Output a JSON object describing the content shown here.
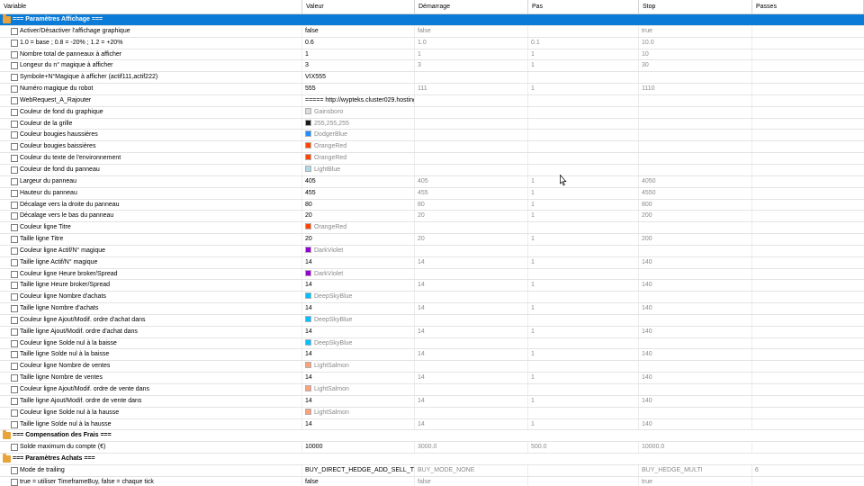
{
  "columns": [
    "Variable",
    "Valeur",
    "Démarrage",
    "Pas",
    "Stop",
    "Passes"
  ],
  "rows": [
    {
      "type": "section",
      "title": "=== Paramètres Affichage ===",
      "selected": true
    },
    {
      "type": "param",
      "name": "Activer/Désactiver l'affichage graphique",
      "value": "false",
      "start": "false",
      "step": "",
      "stop": "true",
      "passes": ""
    },
    {
      "type": "param",
      "name": "1.0 = base ; 0.8 = -20% ; 1.2 = +20%",
      "value": "0.6",
      "start": "1.0",
      "step": "0.1",
      "stop": "10.0",
      "passes": ""
    },
    {
      "type": "param",
      "name": "Nombre total de panneaux à afficher",
      "value": "1",
      "start": "1",
      "step": "1",
      "stop": "10",
      "passes": ""
    },
    {
      "type": "param",
      "name": "Longeur du n° magique à afficher",
      "value": "3",
      "start": "3",
      "step": "1",
      "stop": "30",
      "passes": ""
    },
    {
      "type": "param",
      "name": "Symbole+N°Magique à afficher (actif111,actif222)",
      "value": "VIX555",
      "start": "",
      "step": "",
      "stop": "",
      "passes": ""
    },
    {
      "type": "param",
      "name": "Numéro magique du robot",
      "value": "555",
      "start": "111",
      "step": "1",
      "stop": "1110",
      "passes": ""
    },
    {
      "type": "param",
      "name": "WebRequest_A_Rajouter",
      "value": "===== http://wypteks.cluster029.hosting.ovh.net =====",
      "start": "",
      "step": "",
      "stop": "",
      "passes": ""
    },
    {
      "type": "color",
      "name": "Couleur de fond du graphique",
      "value": "Gainsboro",
      "color": "#dcdcdc"
    },
    {
      "type": "color",
      "name": "Couleur de la grille",
      "value": "255,255,255",
      "color": "#1a1a1a"
    },
    {
      "type": "color",
      "name": "Couleur bougies haussières",
      "value": "DodgerBlue",
      "color": "#1e90ff"
    },
    {
      "type": "color",
      "name": "Couleur bougies baissières",
      "value": "OrangeRed",
      "color": "#ff4500"
    },
    {
      "type": "color",
      "name": "Couleur du texte de l'environnement",
      "value": "OrangeRed",
      "color": "#ff4500"
    },
    {
      "type": "color",
      "name": "Couleur de fond du panneau",
      "value": "LightBlue",
      "color": "#add8e6"
    },
    {
      "type": "param",
      "name": "Largeur du panneau",
      "value": "405",
      "start": "405",
      "step": "1",
      "stop": "4050",
      "passes": ""
    },
    {
      "type": "param",
      "name": "Hauteur du panneau",
      "value": "455",
      "start": "455",
      "step": "1",
      "stop": "4550",
      "passes": ""
    },
    {
      "type": "param",
      "name": "Décalage vers la droite du panneau",
      "value": "80",
      "start": "80",
      "step": "1",
      "stop": "800",
      "passes": ""
    },
    {
      "type": "param",
      "name": "Décalage vers le bas du panneau",
      "value": "20",
      "start": "20",
      "step": "1",
      "stop": "200",
      "passes": ""
    },
    {
      "type": "color",
      "name": "Couleur ligne Titre",
      "value": "OrangeRed",
      "color": "#ff4500"
    },
    {
      "type": "param",
      "name": "Taille ligne Titre",
      "value": "20",
      "start": "20",
      "step": "1",
      "stop": "200",
      "passes": ""
    },
    {
      "type": "color",
      "name": "Couleur ligne Actif/N° magique",
      "value": "DarkViolet",
      "color": "#9400d3"
    },
    {
      "type": "param",
      "name": "Taille ligne Actif/N° magique",
      "value": "14",
      "start": "14",
      "step": "1",
      "stop": "140",
      "passes": ""
    },
    {
      "type": "color",
      "name": "Couleur ligne Heure broker/Spread",
      "value": "DarkViolet",
      "color": "#9400d3"
    },
    {
      "type": "param",
      "name": "Taille ligne Heure broker/Spread",
      "value": "14",
      "start": "14",
      "step": "1",
      "stop": "140",
      "passes": ""
    },
    {
      "type": "color",
      "name": "Couleur ligne Nombre d'achats",
      "value": "DeepSkyBlue",
      "color": "#00bfff"
    },
    {
      "type": "param",
      "name": "Taille ligne Nombre d'achats",
      "value": "14",
      "start": "14",
      "step": "1",
      "stop": "140",
      "passes": ""
    },
    {
      "type": "color",
      "name": "Couleur ligne Ajout/Modif. ordre d'achat dans",
      "value": "DeepSkyBlue",
      "color": "#00bfff"
    },
    {
      "type": "param",
      "name": "Taille ligne Ajout/Modif. ordre d'achat dans",
      "value": "14",
      "start": "14",
      "step": "1",
      "stop": "140",
      "passes": ""
    },
    {
      "type": "color",
      "name": "Couleur ligne Solde nul à la baisse",
      "value": "DeepSkyBlue",
      "color": "#00bfff"
    },
    {
      "type": "param",
      "name": "Taille ligne Solde nul à la baisse",
      "value": "14",
      "start": "14",
      "step": "1",
      "stop": "140",
      "passes": ""
    },
    {
      "type": "color",
      "name": "Couleur ligne Nombre de ventes",
      "value": "LightSalmon",
      "color": "#ffa07a"
    },
    {
      "type": "param",
      "name": "Taille ligne Nombre de ventes",
      "value": "14",
      "start": "14",
      "step": "1",
      "stop": "140",
      "passes": ""
    },
    {
      "type": "color",
      "name": "Couleur ligne Ajout/Modif. ordre de vente dans",
      "value": "LightSalmon",
      "color": "#ffa07a"
    },
    {
      "type": "param",
      "name": "Taille ligne Ajout/Modif. ordre de vente dans",
      "value": "14",
      "start": "14",
      "step": "1",
      "stop": "140",
      "passes": ""
    },
    {
      "type": "color",
      "name": "Couleur ligne Solde nul à la hausse",
      "value": "LightSalmon",
      "color": "#ffa07a"
    },
    {
      "type": "param",
      "name": "Taille ligne Solde nul à la hausse",
      "value": "14",
      "start": "14",
      "step": "1",
      "stop": "140",
      "passes": ""
    },
    {
      "type": "section",
      "title": "=== Compensation des Frais ===",
      "selected": false
    },
    {
      "type": "param",
      "name": "Solde maximum du compte (€)",
      "value": "10000",
      "start": "3000.0",
      "step": "500.0",
      "stop": "10000.0",
      "passes": ""
    },
    {
      "type": "section",
      "title": "=== Paramètres Achats ===",
      "selected": false
    },
    {
      "type": "param",
      "name": "Mode de trailing",
      "value": "BUY_DIRECT_HEDGE_ADD_SELL_TP",
      "start": "BUY_MODE_NONE",
      "step": "",
      "stop": "BUY_HEDGE_MULTI",
      "passes": "6"
    },
    {
      "type": "param",
      "name": "true = utiliser TimeframeBuy, false = chaque tick",
      "value": "false",
      "start": "false",
      "step": "",
      "stop": "true",
      "passes": ""
    }
  ]
}
